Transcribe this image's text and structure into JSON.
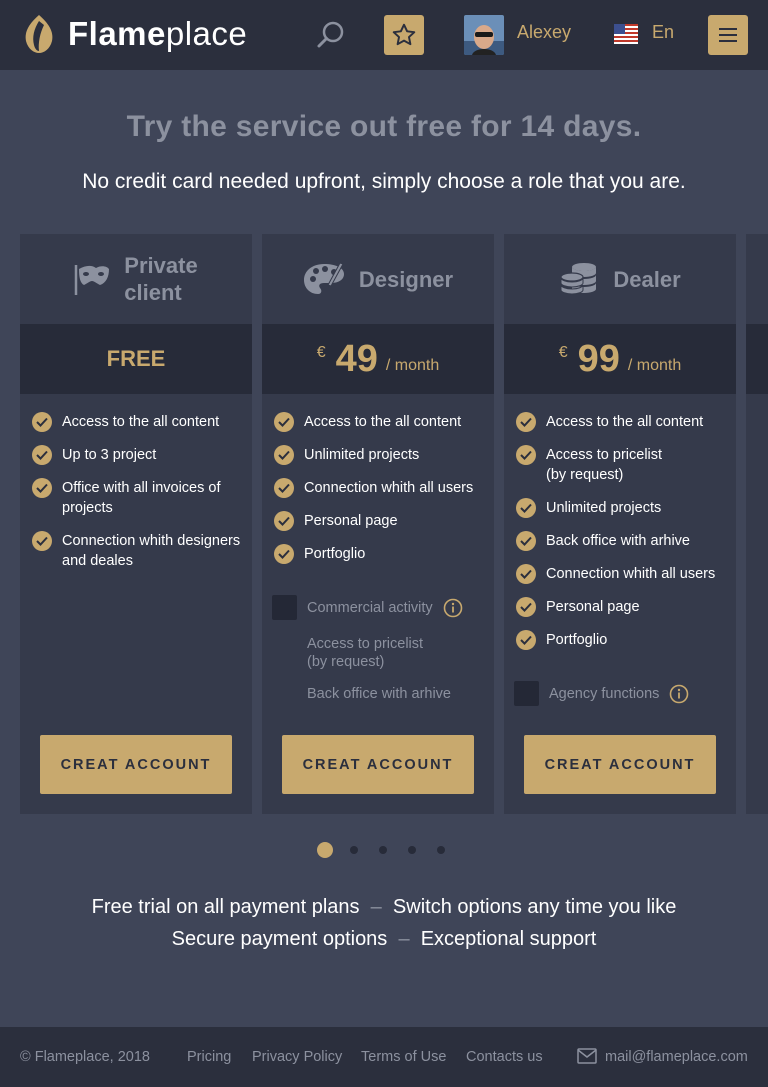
{
  "header": {
    "logo_bold": "Flame",
    "logo_light": "place",
    "username": "Alexey",
    "language": "En",
    "icons": {
      "search": "search-icon",
      "favorites": "star-icon",
      "menu": "hamburger-icon",
      "flag": "us-flag-icon"
    }
  },
  "hero": {
    "title": "Try the service out free for 14 days.",
    "subtitle": "No credit card needed upfront, simply choose a role that you are."
  },
  "plans": [
    {
      "title_line1": "Private",
      "title_line2": "client",
      "icon": "mask-icon",
      "price_label": "FREE",
      "features": [
        "Access to the all content",
        "Up to 3 project",
        "Office with all invoices of projects",
        "Connection whith designers and deales"
      ],
      "button": "CREAT ACCOUNT"
    },
    {
      "title": "Designer",
      "icon": "palette-icon",
      "currency": "€",
      "price": "49",
      "period": "/ month",
      "features": [
        "Access to the all content",
        "Unlimited projects",
        "Connection whith all users",
        "Personal page",
        "Portfoglio"
      ],
      "option": "Commercial activity",
      "option_extras": [
        "Access to pricelist",
        "(by request)",
        "Back office with arhive"
      ],
      "button": "CREAT ACCOUNT"
    },
    {
      "title": "Dealer",
      "icon": "coins-icon",
      "currency": "€",
      "price": "99",
      "period": "/ month",
      "features": [
        "Access to the all content",
        "Access to pricelist (by request)",
        "Unlimited projects",
        "Back office with arhive",
        "Connection whith all users",
        "Personal page",
        "Portfoglio"
      ],
      "option": "Agency functions",
      "button": "CREAT ACCOUNT"
    }
  ],
  "pagination": {
    "count": 5,
    "active": 1
  },
  "notes": {
    "line1_a": "Free trial on all payment plans",
    "line1_b": "Switch options any time you like",
    "line2_a": "Secure payment options",
    "line2_b": "Exceptional support",
    "separator": "–"
  },
  "footer": {
    "copyright": "© Flameplace, 2018",
    "links": [
      "Pricing",
      "Privacy Policy",
      "Terms of Use",
      "Contacts us"
    ],
    "email": "mail@flameplace.com"
  },
  "colors": {
    "accent": "#c8a96e",
    "background": "#3f4558",
    "header": "#2b2f3d",
    "card": "#353a4b"
  }
}
